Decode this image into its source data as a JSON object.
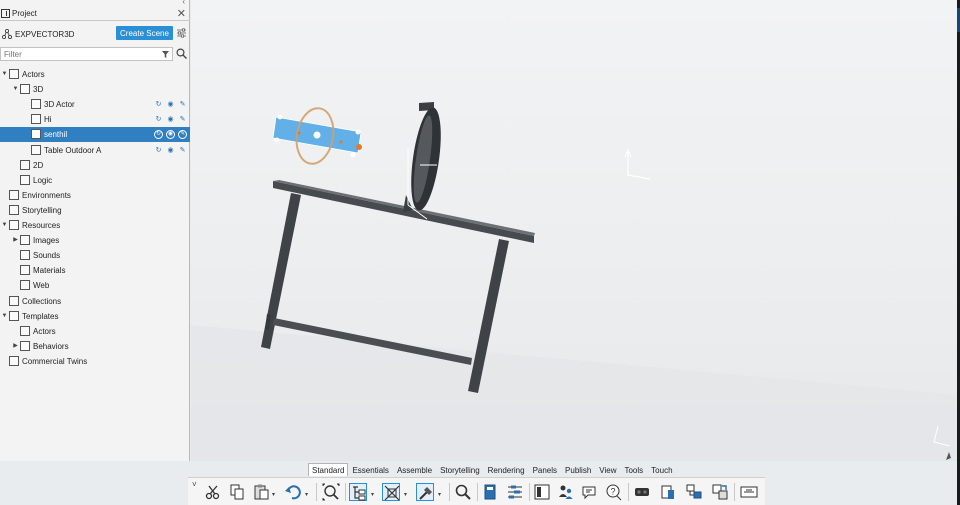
{
  "panel": {
    "tab_title": "Project",
    "project_name": "EXPVECTOR3D",
    "create_scene_label": "Create Scene",
    "filter_placeholder": "Filter"
  },
  "tree": [
    {
      "label": "Actors",
      "depth": 0,
      "expanded": true,
      "icon": "actors-icon"
    },
    {
      "label": "3D",
      "depth": 1,
      "expanded": true,
      "icon": "3d-folder-icon"
    },
    {
      "label": "3D Actor",
      "depth": 2,
      "icon": "actor-node-icon",
      "actions": true
    },
    {
      "label": "Hi",
      "depth": 2,
      "icon": "cube-icon",
      "actions": true
    },
    {
      "label": "senthil",
      "depth": 2,
      "icon": "cube-icon",
      "actions": true,
      "selected": true
    },
    {
      "label": "Table Outdoor A",
      "depth": 2,
      "icon": "cube-icon",
      "actions": true
    },
    {
      "label": "2D",
      "depth": 1,
      "icon": "2d-folder-icon"
    },
    {
      "label": "Logic",
      "depth": 1,
      "icon": "logic-icon"
    },
    {
      "label": "Environments",
      "depth": 0,
      "icon": "environment-icon"
    },
    {
      "label": "Storytelling",
      "depth": 0,
      "icon": "storytelling-icon"
    },
    {
      "label": "Resources",
      "depth": 0,
      "expanded": true,
      "icon": "resources-icon"
    },
    {
      "label": "Images",
      "depth": 1,
      "collapsed": true,
      "icon": "images-icon"
    },
    {
      "label": "Sounds",
      "depth": 1,
      "icon": "sounds-icon"
    },
    {
      "label": "Materials",
      "depth": 1,
      "icon": "materials-icon"
    },
    {
      "label": "Web",
      "depth": 1,
      "icon": "web-icon"
    },
    {
      "label": "Collections",
      "depth": 0,
      "icon": "collections-icon"
    },
    {
      "label": "Templates",
      "depth": 0,
      "expanded": true,
      "icon": "templates-icon"
    },
    {
      "label": "Actors",
      "depth": 1,
      "icon": "actors-template-icon"
    },
    {
      "label": "Behaviors",
      "depth": 1,
      "collapsed": true,
      "icon": "behaviors-icon"
    },
    {
      "label": "Commercial Twins",
      "depth": 0,
      "icon": "commercial-twins-icon"
    }
  ],
  "tabs": [
    "Standard",
    "Essentials",
    "Assemble",
    "Storytelling",
    "Rendering",
    "Panels",
    "Publish",
    "View",
    "Tools",
    "Touch"
  ],
  "active_tab": "Standard",
  "toolbar_icons": [
    "cut-icon",
    "copy-icon",
    "paste-icon",
    "undo-icon",
    "zoom-fit-icon",
    "tree-view-icon",
    "select-mode-icon",
    "manipulate-icon",
    "search-icon",
    "library-icon",
    "timeline-icon",
    "document-icon",
    "people-icon",
    "chat-icon",
    "help-icon",
    "vr-headset-icon",
    "device-icon",
    "network-icon",
    "swap-icon",
    "present-icon"
  ],
  "colors": {
    "accent": "#2b8fd6",
    "selection": "#2f7fc1",
    "actor_bg": "#4aa3e6"
  }
}
